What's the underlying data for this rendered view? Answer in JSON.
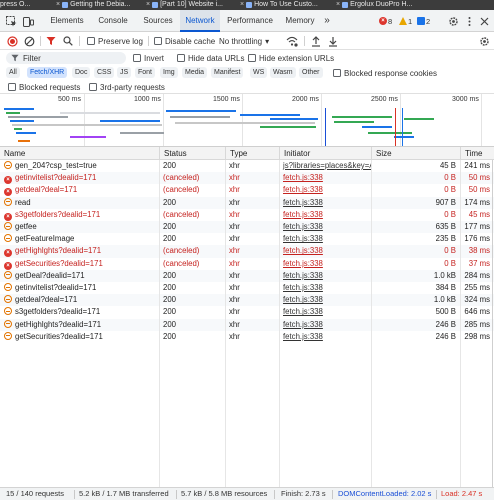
{
  "browser_tabs": [
    {
      "label": "press O...",
      "close": ""
    },
    {
      "label": "Getting the Debia...",
      "close": "×"
    },
    {
      "label": "[Part 10] Website i...",
      "close": "×"
    },
    {
      "label": "How To Use Custo...",
      "close": "×"
    },
    {
      "label": "Ergolux DuoPro H...",
      "close": "×"
    }
  ],
  "devtools": {
    "panel_tabs": [
      "Elements",
      "Console",
      "Sources",
      "Network",
      "Performance",
      "Memory"
    ],
    "active_tab": "Network",
    "more_tabs": "»",
    "errors": "8",
    "warnings": "1",
    "issues": "2"
  },
  "toolbar": {
    "preserve_log": "Preserve log",
    "disable_cache": "Disable cache",
    "throttling": "No throttling",
    "throttling_caret": "▾"
  },
  "filter": {
    "placeholder": "Filter",
    "invert": "Invert",
    "hide_data_urls": "Hide data URLs",
    "hide_extension_urls": "Hide extension URLs"
  },
  "type_chips": [
    "All",
    "Fetch/XHR",
    "Doc",
    "CSS",
    "JS",
    "Font",
    "Img",
    "Media",
    "Manifest",
    "WS",
    "Wasm",
    "Other"
  ],
  "active_chip": "Fetch/XHR",
  "blocked_response_cookies": "Blocked response cookies",
  "blocked_requests": "Blocked requests",
  "third_party": "3rd-party requests",
  "overview_ticks": [
    "500 ms",
    "1000 ms",
    "1500 ms",
    "2000 ms",
    "2500 ms",
    "3000 ms"
  ],
  "columns": {
    "name": "Name",
    "status": "Status",
    "type": "Type",
    "initiator": "Initiator",
    "size": "Size",
    "time": "Time"
  },
  "rows": [
    {
      "name": "gen_204?csp_test=true",
      "status": "200",
      "type": "xhr",
      "initiator": "js?libraries=places&key=A",
      "size": "45 B",
      "time": "241 ms",
      "error": false
    },
    {
      "name": "getinvitelist?dealid=171",
      "status": "(canceled)",
      "type": "xhr",
      "initiator": "fetch.js:338",
      "size": "0 B",
      "time": "50 ms",
      "error": true
    },
    {
      "name": "getdeal?deal=171",
      "status": "(canceled)",
      "type": "xhr",
      "initiator": "fetch.js:338",
      "size": "0 B",
      "time": "50 ms",
      "error": true
    },
    {
      "name": "read",
      "status": "200",
      "type": "xhr",
      "initiator": "fetch.js:338",
      "size": "907 B",
      "time": "174 ms",
      "error": false
    },
    {
      "name": "s3getfolders?dealid=171",
      "status": "(canceled)",
      "type": "xhr",
      "initiator": "fetch.js:338",
      "size": "0 B",
      "time": "45 ms",
      "error": true
    },
    {
      "name": "getfee",
      "status": "200",
      "type": "xhr",
      "initiator": "fetch.js:338",
      "size": "635 B",
      "time": "177 ms",
      "error": false
    },
    {
      "name": "getFeatureImage",
      "status": "200",
      "type": "xhr",
      "initiator": "fetch.js:338",
      "size": "235 B",
      "time": "176 ms",
      "error": false
    },
    {
      "name": "getHighlghts?dealid=171",
      "status": "(canceled)",
      "type": "xhr",
      "initiator": "fetch.js:338",
      "size": "0 B",
      "time": "38 ms",
      "error": true
    },
    {
      "name": "getSecurities?dealid=171",
      "status": "(canceled)",
      "type": "xhr",
      "initiator": "fetch.js:338",
      "size": "0 B",
      "time": "37 ms",
      "error": true
    },
    {
      "name": "getDeal?dealid=171",
      "status": "200",
      "type": "xhr",
      "initiator": "fetch.js:338",
      "size": "1.0 kB",
      "time": "284 ms",
      "error": false
    },
    {
      "name": "getinvitelist?dealid=171",
      "status": "200",
      "type": "xhr",
      "initiator": "fetch.js:338",
      "size": "384 B",
      "time": "255 ms",
      "error": false
    },
    {
      "name": "getdeal?deal=171",
      "status": "200",
      "type": "xhr",
      "initiator": "fetch.js:338",
      "size": "1.0 kB",
      "time": "324 ms",
      "error": false
    },
    {
      "name": "s3getfolders?dealid=171",
      "status": "200",
      "type": "xhr",
      "initiator": "fetch.js:338",
      "size": "500 B",
      "time": "646 ms",
      "error": false
    },
    {
      "name": "getHighlghts?dealid=171",
      "status": "200",
      "type": "xhr",
      "initiator": "fetch.js:338",
      "size": "246 B",
      "time": "285 ms",
      "error": false
    },
    {
      "name": "getSecurities?dealid=171",
      "status": "200",
      "type": "xhr",
      "initiator": "fetch.js:338",
      "size": "246 B",
      "time": "298 ms",
      "error": false
    }
  ],
  "status_bar": {
    "requests": "15 / 140 requests",
    "transferred": "5.2 kB / 1.7 MB transferred",
    "resources": "5.7 kB / 5.8 MB resources",
    "finish": "Finish: 2.73 s",
    "dom_content_loaded": "DOMContentLoaded: 2.02 s",
    "load": "Load: 2.47 s"
  },
  "colors": {
    "accent": "#0b57d0",
    "error": "#c5221f",
    "dom_content_loaded": "#1a4fd6",
    "load": "#d93025"
  }
}
